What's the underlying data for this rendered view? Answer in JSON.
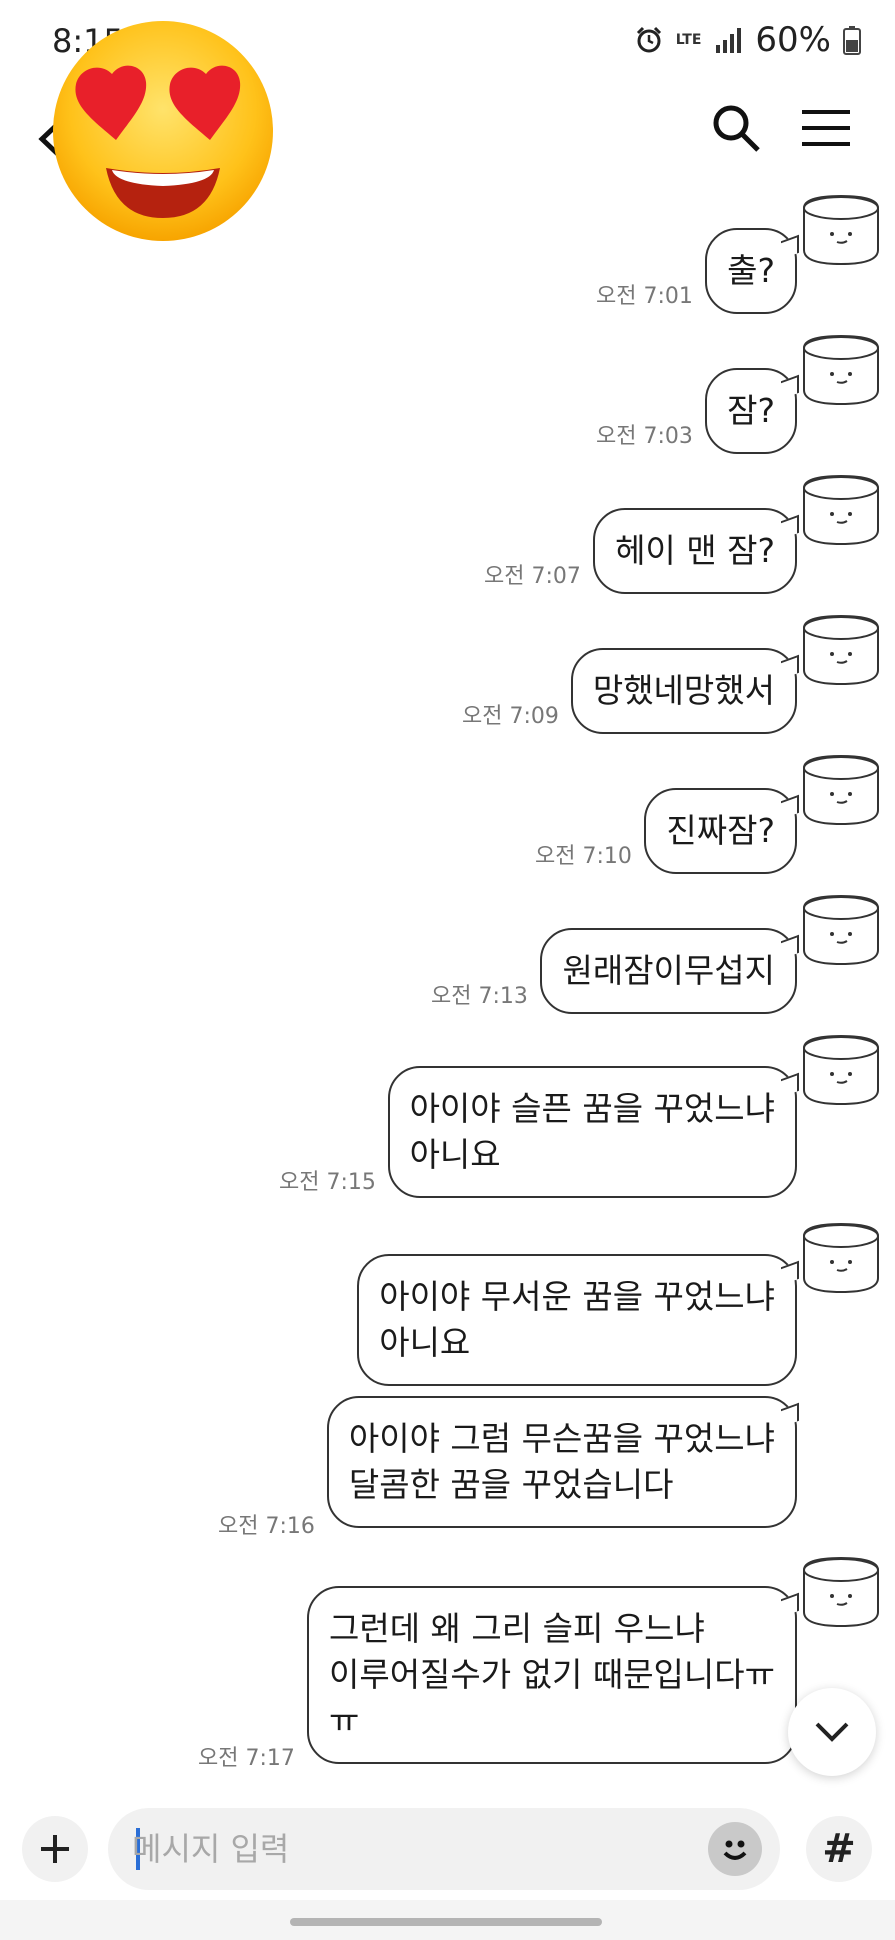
{
  "status_bar": {
    "time": "8:15",
    "network": "LTE",
    "battery": "60%"
  },
  "header": {
    "back_icon": "back-arrow-icon",
    "search_icon": "search-icon",
    "menu_icon": "hamburger-menu-icon",
    "sticker_icon": "heart-eyes-emoji-icon"
  },
  "messages": [
    {
      "text": "출?",
      "time": "오전 7:01",
      "avatar": true
    },
    {
      "text": "잠?",
      "time": "오전 7:03",
      "avatar": true
    },
    {
      "text": "헤이 맨 잠?",
      "time": "오전 7:07",
      "avatar": true
    },
    {
      "text": "망했네망했서",
      "time": "오전 7:09",
      "avatar": true
    },
    {
      "text": "진짜잠?",
      "time": "오전 7:10",
      "avatar": true
    },
    {
      "text": "원래잠이무섭지",
      "time": "오전 7:13",
      "avatar": true
    },
    {
      "text": "아이야 슬픈 꿈을 꾸었느냐\n아니요",
      "time": "오전 7:15",
      "avatar": true
    },
    {
      "text": "아이야 무서운 꿈을 꾸었느냐\n아니요",
      "time": "",
      "avatar": true
    },
    {
      "text": "아이야 그럼 무슨꿈을 꾸었느냐\n달콤한 꿈을 꾸었습니다",
      "time": "오전 7:16",
      "avatar": false
    },
    {
      "text": "그런데 왜 그리 슬피 우느냐\n이루어질수가 없기 때문입니다ㅠ\nㅠ",
      "time": "오전 7:17",
      "avatar": true
    }
  ],
  "composer": {
    "placeholder": "메시지 입력",
    "plus_icon": "plus-icon",
    "emoji_icon": "smiley-icon",
    "hash_label": "#",
    "scroll_down_icon": "chevron-down-icon"
  }
}
